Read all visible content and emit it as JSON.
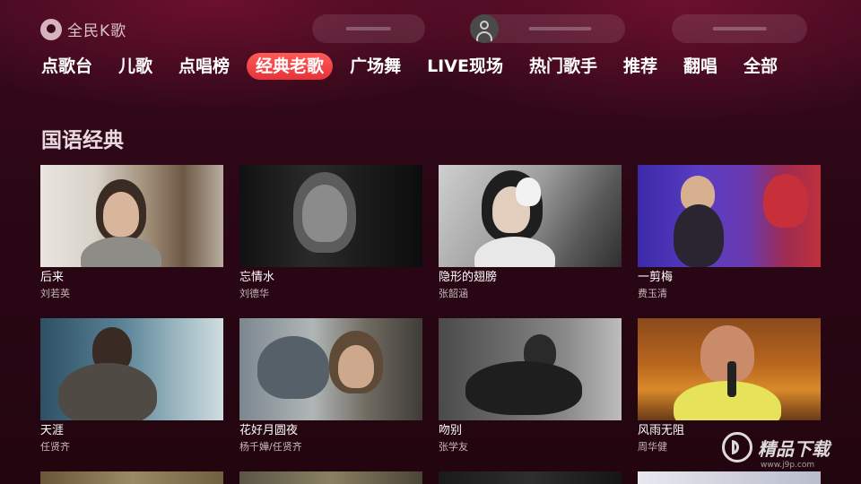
{
  "app": {
    "title": "全民K歌"
  },
  "nav": {
    "items": [
      {
        "label": "点歌台"
      },
      {
        "label": "儿歌"
      },
      {
        "label": "点唱榜"
      },
      {
        "label": "经典老歌",
        "active": true
      },
      {
        "label": "广场舞"
      },
      {
        "label": "LIVE现场"
      },
      {
        "label": "热门歌手"
      },
      {
        "label": "推荐"
      },
      {
        "label": "翻唱"
      },
      {
        "label": "全部"
      }
    ]
  },
  "section": {
    "title": "国语经典"
  },
  "songs": [
    {
      "title": "后来",
      "artist": "刘若英"
    },
    {
      "title": "忘情水",
      "artist": "刘德华"
    },
    {
      "title": "隐形的翅膀",
      "artist": "张韶涵"
    },
    {
      "title": "一剪梅",
      "artist": "费玉清"
    },
    {
      "title": "天涯",
      "artist": "任贤齐"
    },
    {
      "title": "花好月圆夜",
      "artist": "杨千嬅/任贤齐"
    },
    {
      "title": "吻别",
      "artist": "张学友"
    },
    {
      "title": "风雨无阻",
      "artist": "周华健"
    }
  ],
  "watermark": {
    "text": "精品下载",
    "sub": "www.j9p.com"
  },
  "colors": {
    "accent": "#e5333a",
    "background": "#2c0716"
  }
}
